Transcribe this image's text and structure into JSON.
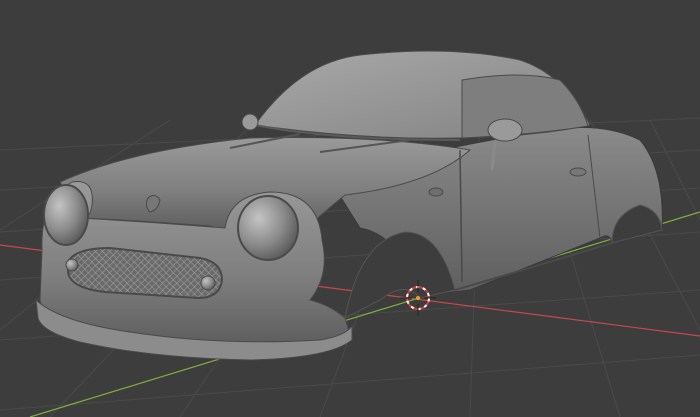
{
  "viewport": {
    "background": "#3d3d3d",
    "grid_color": "#4a4a4a",
    "x_axis_color": "#c9474f",
    "y_axis_color": "#7fb03a",
    "cursor_colors": [
      "#ffffff",
      "#d63a3a"
    ],
    "mesh_color": "#8f8f8f"
  },
  "scene": {
    "object_type": "car-body-mesh",
    "grid": true,
    "axes": [
      "x-axis",
      "y-axis"
    ],
    "cursor": "3d-cursor-icon"
  }
}
